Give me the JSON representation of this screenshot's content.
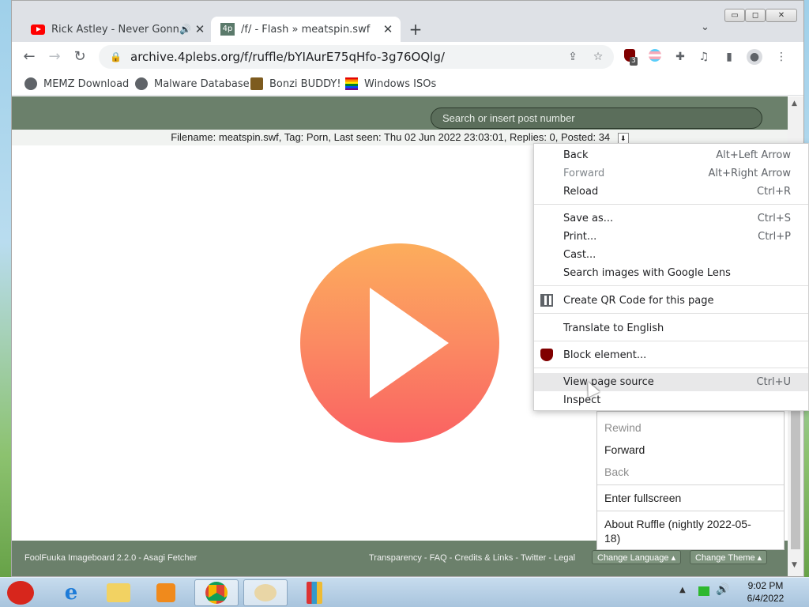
{
  "tabs": [
    {
      "title": "Rick Astley - Never Gonna Give You Up",
      "icon": "youtube-icon",
      "audio": true
    },
    {
      "title": "/f/ - Flash » meatspin.swf",
      "favicon_text": "4p",
      "active": true
    }
  ],
  "window_controls": {
    "minimize": "▭",
    "maximize": "◻",
    "close": "✕"
  },
  "toolbar": {
    "url": "archive.4plebs.org/f/ruffle/bYIAurE75qHfo-3g76OQlg/",
    "ublock_badge": "3"
  },
  "bookmarks": [
    "MEMZ Download",
    "Malware Database",
    "Bonzi BUDDY!",
    "Windows ISOs"
  ],
  "page": {
    "search_placeholder": "Search or insert post number",
    "fileinfo": "Filename: meatspin.swf, Tag: Porn, Last seen: Thu 02 Jun 2022 23:03:01, Replies: 0, Posted: 34",
    "footer_left": "FoolFuuka Imageboard 2.2.0 - Asagi Fetcher",
    "footer_links": "Transparency - FAQ - Credits & Links - Twitter - Legal",
    "change_language": "Change Language ▴",
    "change_theme": "Change Theme ▴"
  },
  "ruffle_menu": {
    "rewind": "Rewind",
    "forward": "Forward",
    "back": "Back",
    "fullscreen": "Enter fullscreen",
    "about_line1": "About Ruffle (nightly 2022-05-",
    "about_line2": "18)"
  },
  "context_menu": {
    "back": {
      "label": "Back",
      "shortcut": "Alt+Left Arrow"
    },
    "forward": {
      "label": "Forward",
      "shortcut": "Alt+Right Arrow"
    },
    "reload": {
      "label": "Reload",
      "shortcut": "Ctrl+R"
    },
    "save_as": {
      "label": "Save as...",
      "shortcut": "Ctrl+S"
    },
    "print": {
      "label": "Print...",
      "shortcut": "Ctrl+P"
    },
    "cast": {
      "label": "Cast..."
    },
    "lens": {
      "label": "Search images with Google Lens"
    },
    "qr": {
      "label": "Create QR Code for this page"
    },
    "translate": {
      "label": "Translate to English"
    },
    "block": {
      "label": "Block element..."
    },
    "view_source": {
      "label": "View page source",
      "shortcut": "Ctrl+U"
    },
    "inspect": {
      "label": "Inspect"
    }
  },
  "taskbar": {
    "time": "9:02 PM",
    "date": "6/4/2022"
  },
  "colors": {
    "header_green": "#6b806b",
    "play_top": "#fcad5c",
    "play_bottom": "#fa6162"
  }
}
